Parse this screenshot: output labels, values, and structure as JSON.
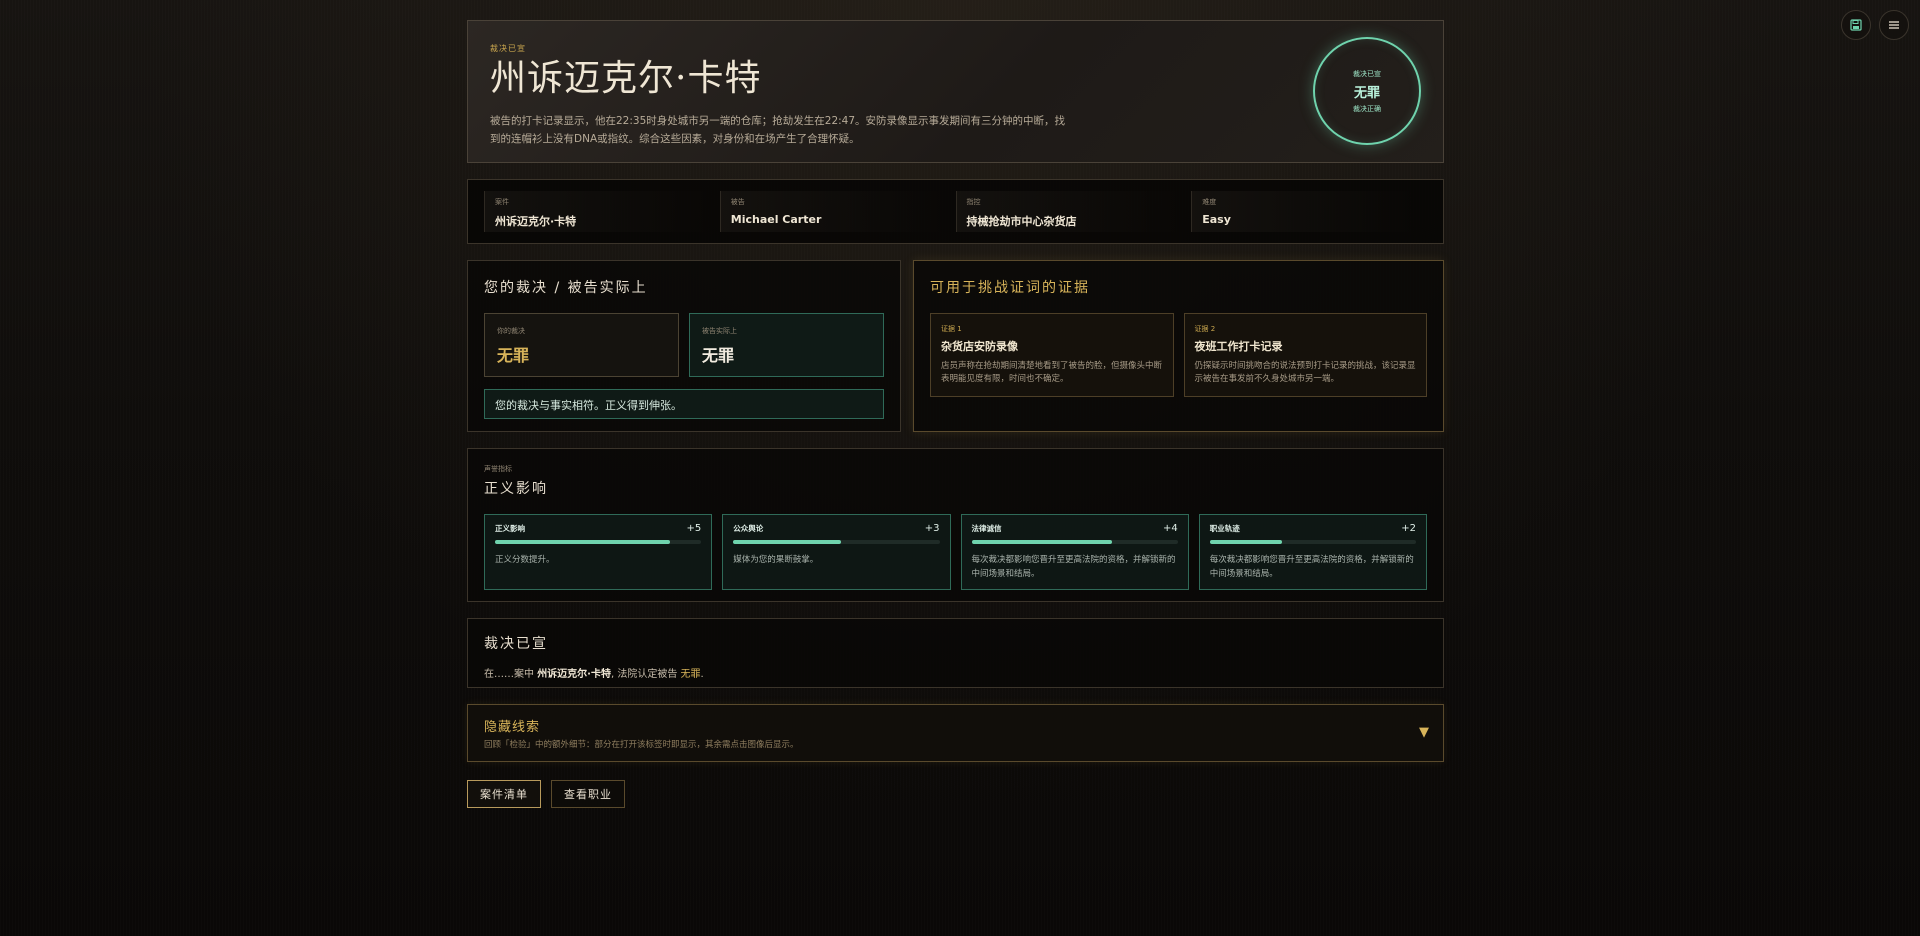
{
  "top_controls": {
    "save_icon": "save-icon",
    "menu_icon": "hamburger-menu-icon"
  },
  "hero": {
    "kicker": "裁决已宣",
    "title": "州诉迈克尔·卡特",
    "description": "被告的打卡记录显示，他在22:35时身处城市另一端的仓库；抢劫发生在22:47。安防录像显示事发期间有三分钟的中断，找到的连帽衫上没有DNA或指纹。综合这些因素，对身份和在场产生了合理怀疑。",
    "stamp": {
      "top": "裁决已宣",
      "verdict": "无罪",
      "bottom": "裁决正确"
    }
  },
  "case_info": [
    {
      "label": "案件",
      "value": "州诉迈克尔·卡特"
    },
    {
      "label": "被告",
      "value": "Michael Carter"
    },
    {
      "label": "指控",
      "value": "持械抢劫市中心杂货店"
    },
    {
      "label": "难度",
      "value": "Easy"
    }
  ],
  "verdict_section": {
    "title": "您的裁决 / 被告实际上",
    "your_verdict_label": "你的裁决",
    "your_verdict": "无罪",
    "actual_label": "被告实际上",
    "actual": "无罪",
    "match_message": "您的裁决与事实相符。正义得到伸张。"
  },
  "evidence_section": {
    "title": "可用于挑战证词的证据",
    "items": [
      {
        "label": "证据 1",
        "title": "杂货店安防录像",
        "description": "店员声称在抢劫期间清楚地看到了被告的脸，但摄像头中断表明能见度有限，时间也不确定。"
      },
      {
        "label": "证据 2",
        "title": "夜班工作打卡记录",
        "description": "仍探疑示时间挑吻合的说法预到打卡记录的挑战，该记录显示被告在事发前不久身处城市另一端。"
      }
    ]
  },
  "impact_section": {
    "kicker": "声誉指标",
    "title": "正义影响",
    "meters": [
      {
        "name": "正义影响",
        "points": "+5",
        "fill": 0.85,
        "description": "正义分数提升。"
      },
      {
        "name": "公众舆论",
        "points": "+3",
        "fill": 0.52,
        "description": "媒体为您的果断鼓掌。"
      },
      {
        "name": "法律诚信",
        "points": "+4",
        "fill": 0.68,
        "description": "每次裁决都影响您晋升至更高法院的资格，并解锁新的中间场景和结局。"
      },
      {
        "name": "职业轨迹",
        "points": "+2",
        "fill": 0.35,
        "description": "每次裁决都影响您晋升至更高法院的资格，并解锁新的中间场景和结局。"
      }
    ]
  },
  "announcement": {
    "title": "裁决已宣",
    "prefix": "在……案中",
    "case_name": "州诉迈克尔·卡特",
    "middle": ", 法院认定被告",
    "verdict": "无罪",
    "suffix": "."
  },
  "hidden_clues": {
    "title": "隐藏线索",
    "description": "回顾「检验」中的额外细节：部分在打开该标签时即显示，其余需点击图像后显示。",
    "arrow_icon": "caret-down-icon"
  },
  "buttons": {
    "case_list": "案件清单",
    "view_career": "查看职业"
  },
  "colors": {
    "accent_gold": "#d8b45a",
    "accent_teal": "#6fd3ad",
    "background": "#0c0a09"
  }
}
